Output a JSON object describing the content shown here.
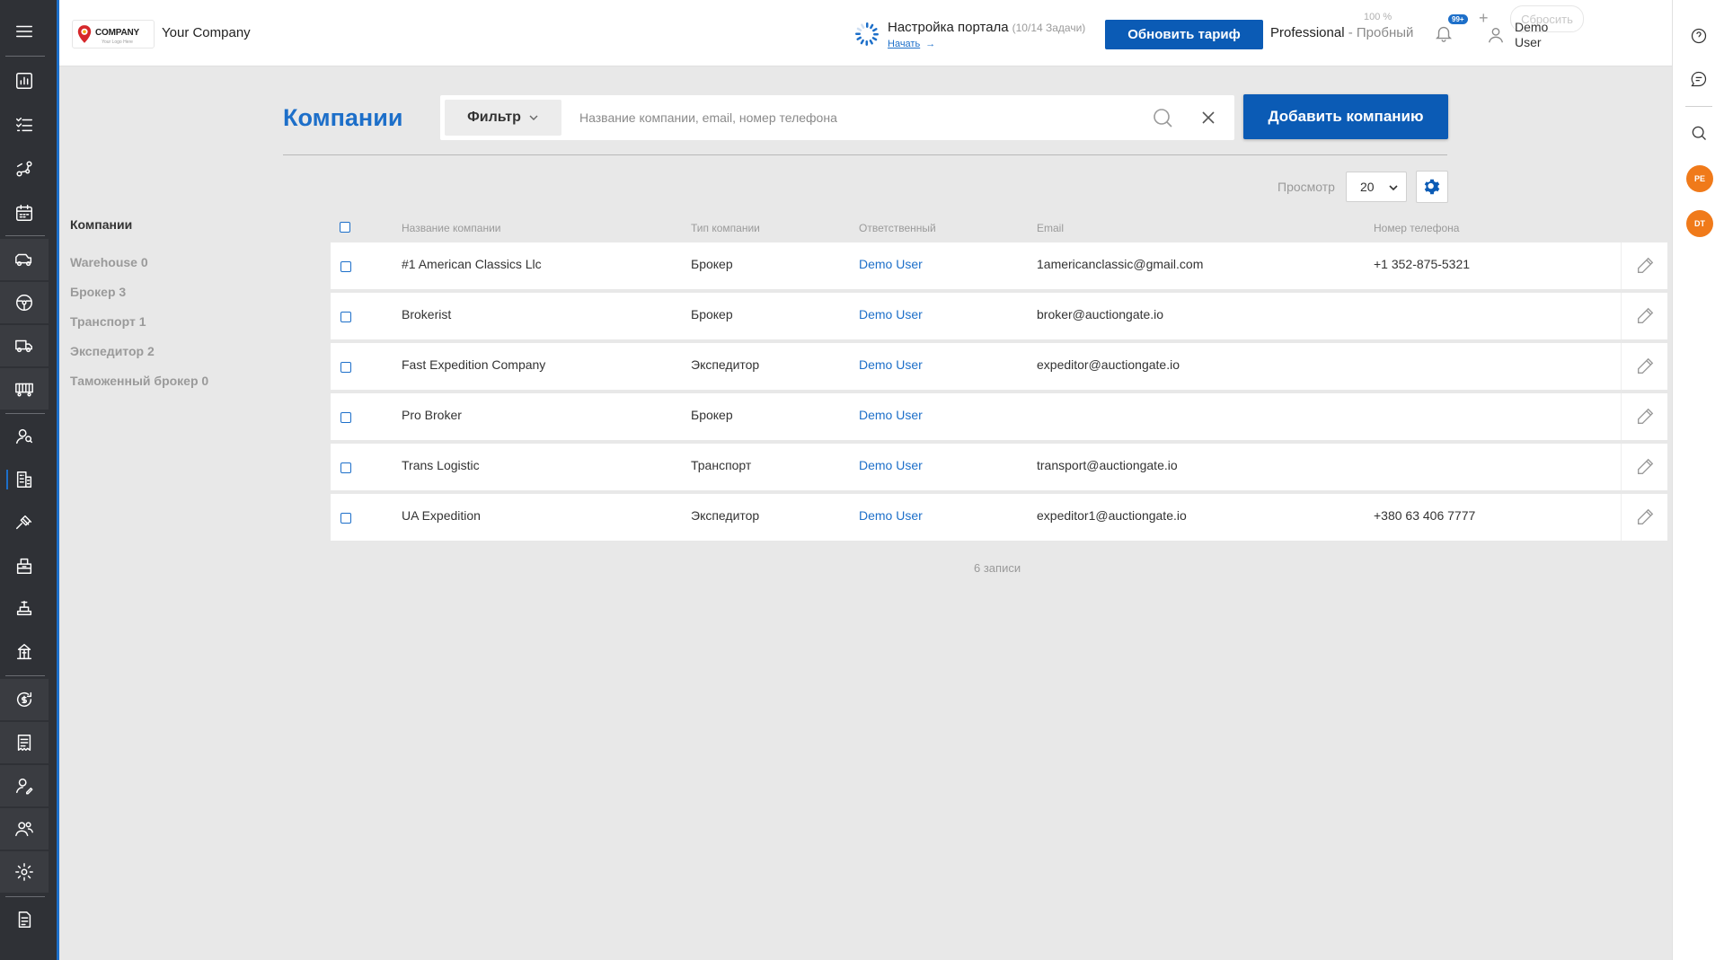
{
  "header": {
    "logo_text": "COMPANY",
    "logo_tagline": "Your Logo Here",
    "company_name": "Your Company",
    "setup_title": "Настройка портала",
    "setup_count": "(10/14 Задачи)",
    "setup_link": "Начать",
    "upgrade_label": "Обновить тариф",
    "plan_name": "Professional",
    "plan_sep": " - ",
    "plan_trial": "Пробный",
    "zoom_percent": "100 %",
    "notif_badge": "99+",
    "reset_label": "Сбросить",
    "user_name": "Demo User"
  },
  "page": {
    "title": "Компании",
    "filter_label": "Фильтр",
    "search_placeholder": "Название компании, email, номер телефона",
    "add_button": "Добавить компанию",
    "view_label": "Просмотр",
    "view_value": "20",
    "records": "6 записи"
  },
  "sidebar": {
    "title": "Компании",
    "items": [
      "Warehouse 0",
      "Брокер 3",
      "Транспорт 1",
      "Экспедитор 2",
      "Таможенный брокер 0"
    ]
  },
  "table": {
    "columns": {
      "name": "Название компании",
      "type": "Тип компании",
      "owner": "Ответственный",
      "email": "Email",
      "phone": "Номер телефона"
    },
    "rows": [
      {
        "name": "#1 American Classics Llc",
        "type": "Брокер",
        "owner": "Demo User",
        "email": "1americanclassic@gmail.com",
        "phone": "+1 352-875-5321"
      },
      {
        "name": "Brokerist",
        "type": "Брокер",
        "owner": "Demo User",
        "email": "broker@auctiongate.io",
        "phone": ""
      },
      {
        "name": "Fast Expedition Company",
        "type": "Экспедитор",
        "owner": "Demo User",
        "email": "expeditor@auctiongate.io",
        "phone": ""
      },
      {
        "name": "Pro Broker",
        "type": "Брокер",
        "owner": "Demo User",
        "email": "",
        "phone": ""
      },
      {
        "name": "Trans Logistic",
        "type": "Транспорт",
        "owner": "Demo User",
        "email": "transport@auctiongate.io",
        "phone": ""
      },
      {
        "name": "UA Expedition",
        "type": "Экспедитор",
        "owner": "Demo User",
        "email": "expeditor1@auctiongate.io",
        "phone": "+380 63 406 7777"
      }
    ]
  },
  "right_rail": {
    "avatars": [
      "PE",
      "DT"
    ]
  },
  "colors": {
    "accent": "#1d6fc9",
    "primary_button": "#0b5bb5",
    "rail": "#2f3136",
    "avatar": "#f07a1a"
  }
}
